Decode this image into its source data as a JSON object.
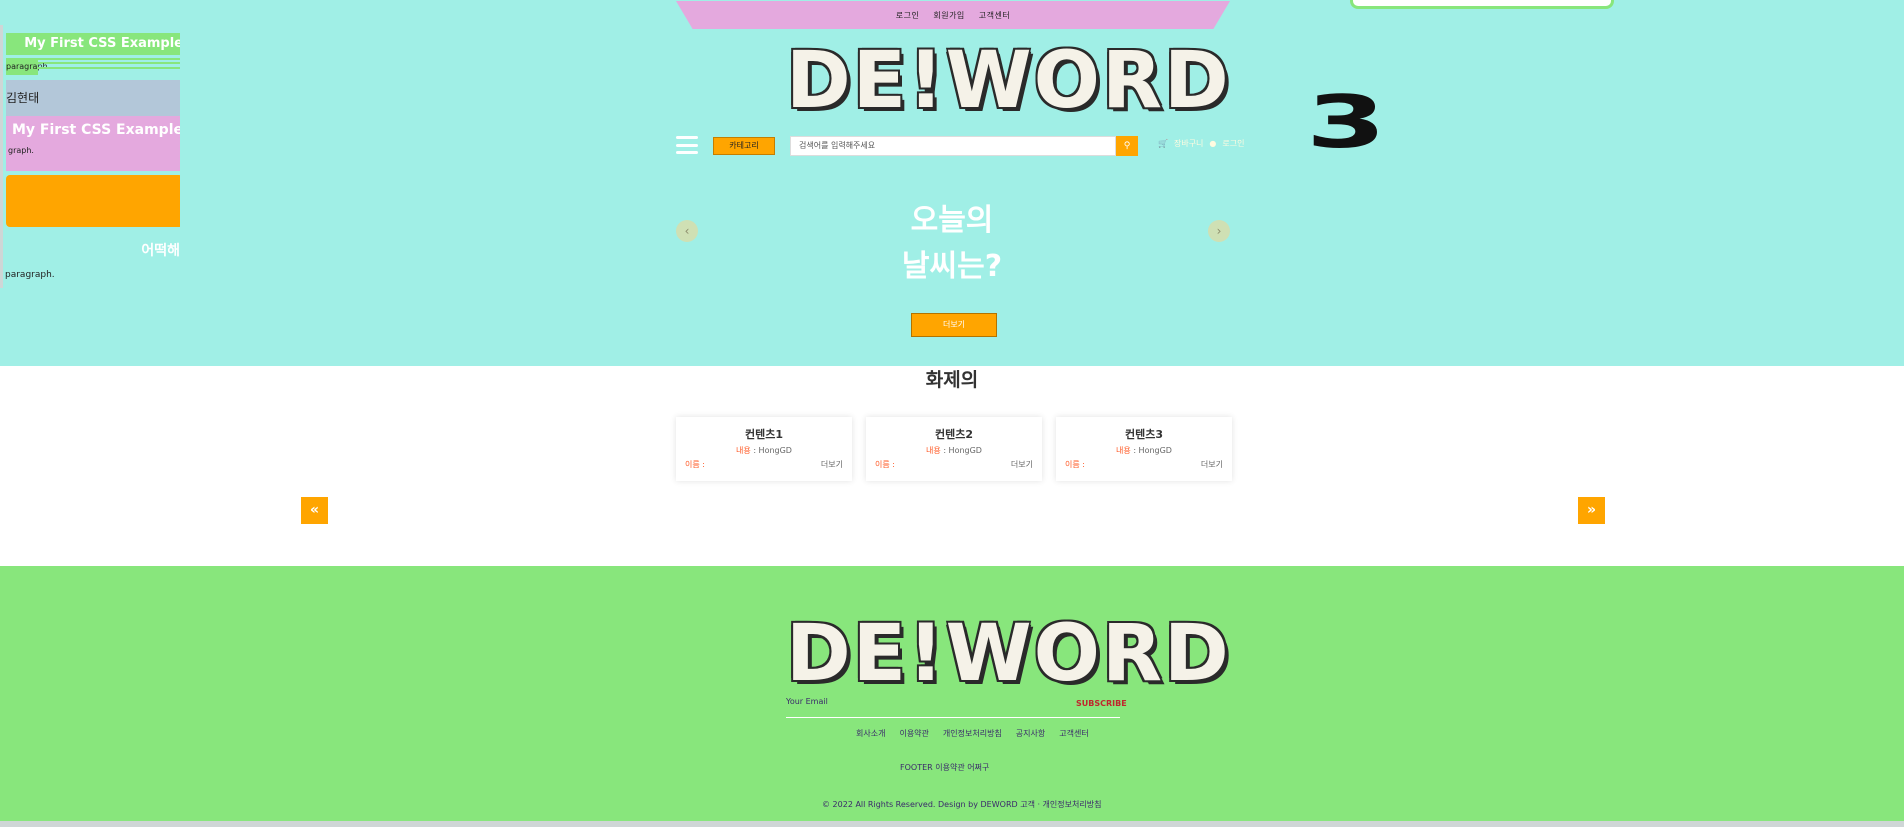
{
  "topbar": {
    "items": [
      "로그인",
      "회원가입",
      "고객센터"
    ]
  },
  "header": {
    "logo": "DE!WORD",
    "counter": "3",
    "category_button": "카테고리",
    "search_placeholder": "검색어를 입력해주세요",
    "search_icon": "search-icon",
    "cart_label": "장바구니",
    "login_label": "로그인",
    "colors": {
      "hero_bg": "#a0efe6",
      "accent": "#ffa500",
      "footer_bg": "#88e67c",
      "topbar_bg": "#e4a9de"
    }
  },
  "slider": {
    "title_line1": "오늘의",
    "title_line2": "날씨는?",
    "prev": "‹",
    "next": "›",
    "button": "더보기"
  },
  "panel": {
    "heading1": "My First CSS Example",
    "para1": "paragraph.",
    "name": "김현태",
    "heading2": "My First CSS Example",
    "para2": "graph.",
    "heading3": "어떡해",
    "para3": "paragraph."
  },
  "trending": {
    "title": "화제의",
    "cards": [
      {
        "title": "컨텐츠1",
        "meta_label": "내용",
        "meta_value": ": HongGD",
        "name_label": "이름 :",
        "more": "더보기"
      },
      {
        "title": "컨텐츠2",
        "meta_label": "내용",
        "meta_value": ": HongGD",
        "name_label": "이름 :",
        "more": "더보기"
      },
      {
        "title": "컨텐츠3",
        "meta_label": "내용",
        "meta_value": ": HongGD",
        "name_label": "이름 :",
        "more": "더보기"
      }
    ],
    "prev": "«",
    "next": "»"
  },
  "footer": {
    "logo": "DE!WORD",
    "email_label": "Your Email",
    "subscribe": "SUBSCRIBE",
    "links": [
      "회사소개",
      "이용약관",
      "개인정보처리방침",
      "공지사항",
      "고객센터"
    ],
    "heading": "FOOTER 이용약관 어쩌구",
    "copyright": "© 2022 All Rights Reserved. Design by DEWORD 고객 · 개인정보처리방침"
  }
}
